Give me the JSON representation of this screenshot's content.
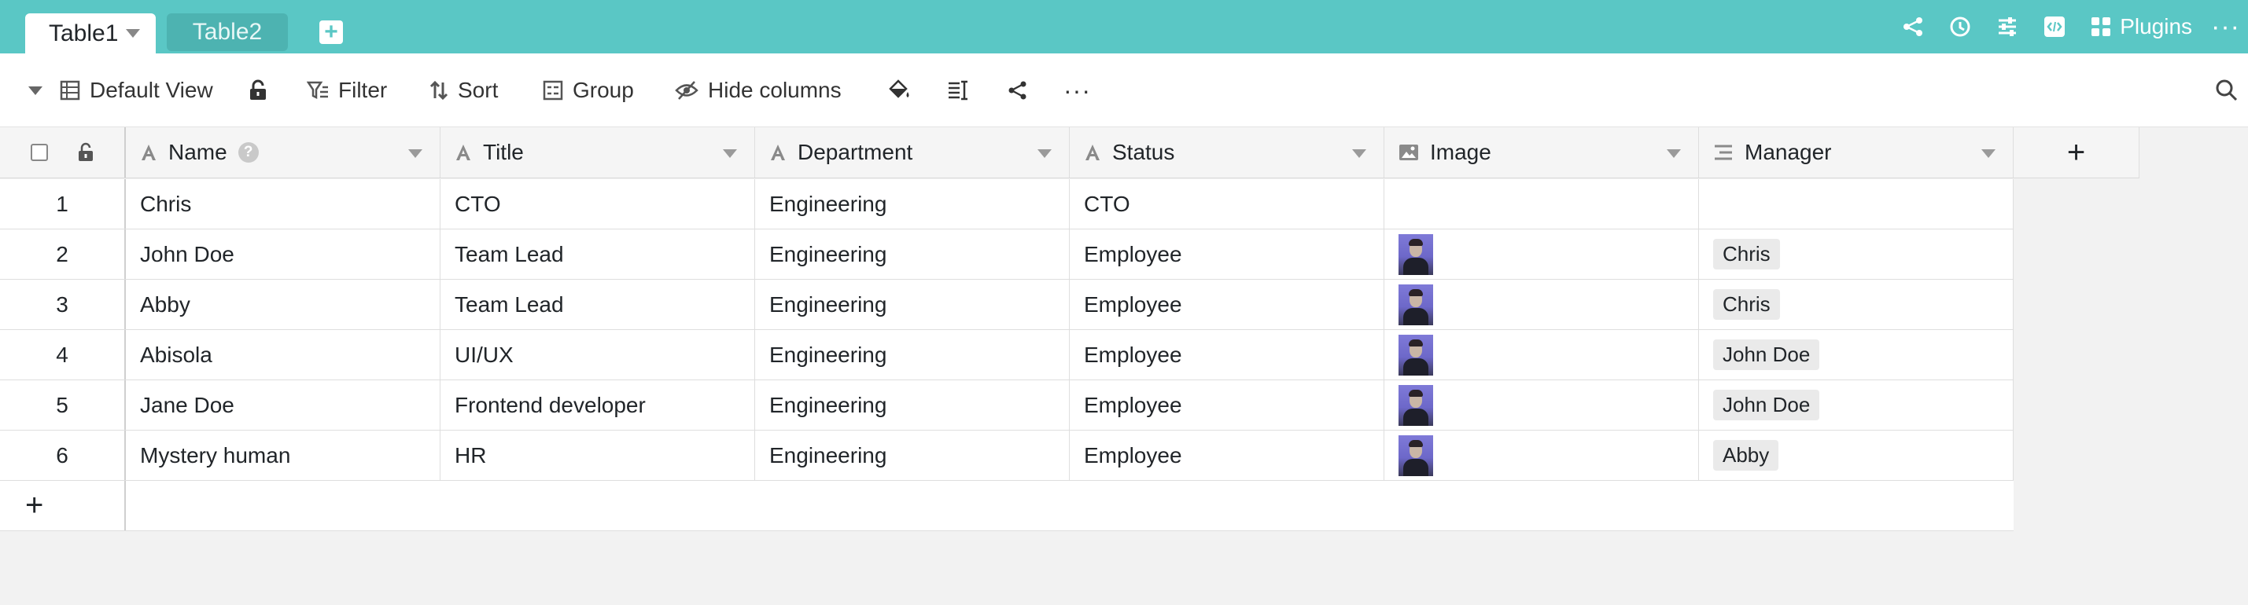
{
  "tabs": {
    "active": "Table1",
    "inactive": "Table2"
  },
  "topbar": {
    "plugins_label": "Plugins",
    "more": "···"
  },
  "toolbar": {
    "view": "Default View",
    "filter": "Filter",
    "sort": "Sort",
    "group": "Group",
    "hide_columns": "Hide columns",
    "more": "···"
  },
  "columns": {
    "name": "Name",
    "title": "Title",
    "department": "Department",
    "status": "Status",
    "image": "Image",
    "manager": "Manager"
  },
  "rows": [
    {
      "index": "1",
      "name": "Chris",
      "title": "CTO",
      "department": "Engineering",
      "status": "CTO",
      "has_image": false,
      "manager": ""
    },
    {
      "index": "2",
      "name": "John Doe",
      "title": "Team Lead",
      "department": "Engineering",
      "status": "Employee",
      "has_image": true,
      "manager": "Chris"
    },
    {
      "index": "3",
      "name": "Abby",
      "title": "Team Lead",
      "department": "Engineering",
      "status": "Employee",
      "has_image": true,
      "manager": "Chris"
    },
    {
      "index": "4",
      "name": "Abisola",
      "title": "UI/UX",
      "department": "Engineering",
      "status": "Employee",
      "has_image": true,
      "manager": "John Doe"
    },
    {
      "index": "5",
      "name": "Jane Doe",
      "title": "Frontend developer",
      "department": "Engineering",
      "status": "Employee",
      "has_image": true,
      "manager": "John Doe"
    },
    {
      "index": "6",
      "name": "Mystery human",
      "title": "HR",
      "department": "Engineering",
      "status": "Employee",
      "has_image": true,
      "manager": "Abby"
    }
  ],
  "colors": {
    "brand": "#5ac7c5",
    "tab_inactive": "#4db3b1",
    "background": "#f2f2f2"
  }
}
